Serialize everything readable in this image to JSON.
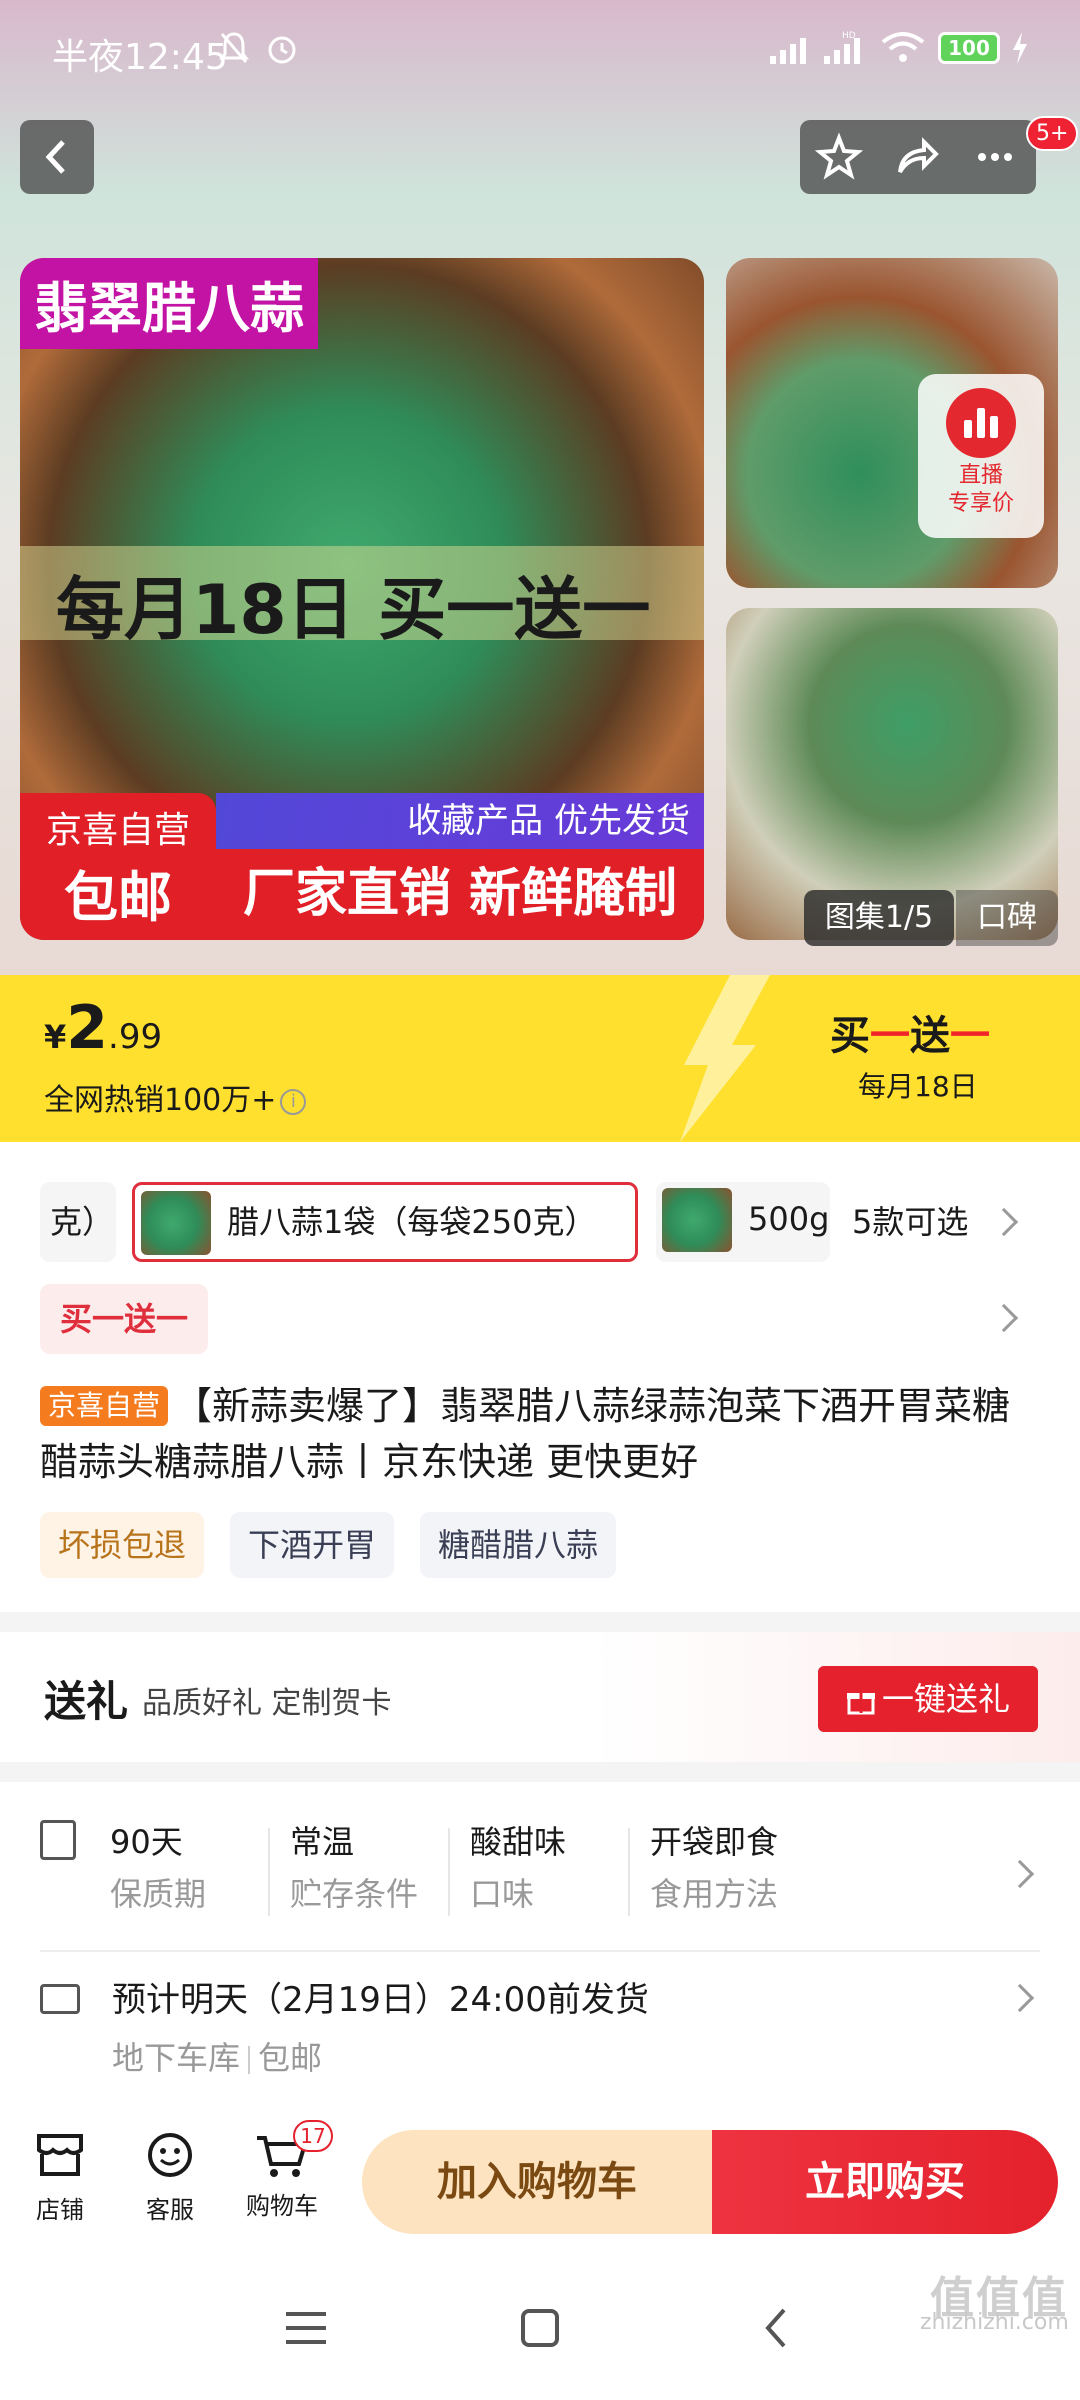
{
  "status_bar": {
    "time": "半夜12:45",
    "battery": "100"
  },
  "header": {
    "cart_badge": "5+"
  },
  "hero": {
    "title": "翡翠腊八蒜",
    "promo": "每月18日 买一送一",
    "self_run_top": "京喜自营",
    "self_run_bottom": "包邮",
    "collect_text": "收藏产品 优先发货",
    "factory_text": "厂家直销 新鲜腌制",
    "live_line1": "直播",
    "live_line2": "专享价",
    "gallery_label": "图集1/5",
    "gallery_extra": "口碑"
  },
  "price_band": {
    "currency": "¥",
    "price_int": "2",
    "price_dec": ".99",
    "sold_text": "全网热销100万+",
    "promo_a": "买",
    "promo_b": "一",
    "promo_c": "送",
    "promo_d": "一",
    "promo_sub": "每月18日"
  },
  "sku": {
    "prev_label": "克）",
    "selected_label": "腊八蒜1袋（每袋250克）",
    "next_label": "500g",
    "count_label": "5款可选"
  },
  "product": {
    "promo_tag": "买一送一",
    "badge": "京喜自营",
    "title": "【新蒜卖爆了】翡翠腊八蒜绿蒜泡菜下酒开胃菜糖醋蒜头糖蒜腊八蒜丨京东快递 更快更好",
    "tags": [
      "坏损包退",
      "下酒开胃",
      "糖醋腊八蒜"
    ]
  },
  "gift": {
    "title": "送礼",
    "subtitle": "品质好礼 定制贺卡",
    "button": "一键送礼"
  },
  "specs": [
    {
      "value": "90天",
      "label": "保质期"
    },
    {
      "value": "常温",
      "label": "贮存条件"
    },
    {
      "value": "酸甜味",
      "label": "口味"
    },
    {
      "value": "开袋即食",
      "label": "食用方法"
    }
  ],
  "shipping": {
    "text": "预计明天（2月19日）24:00前发货",
    "warehouse": "地下车库",
    "free": "包邮"
  },
  "action_bar": {
    "shop": "店铺",
    "service": "客服",
    "cart": "购物车",
    "cart_count": "17",
    "add_to_cart": "加入购物车",
    "buy_now": "立即购买"
  },
  "watermark": {
    "big": "值值值",
    "small": "zhizhizhi.com"
  },
  "colors": {
    "accent_red": "#e4212c",
    "price_yellow": "#ffe02e",
    "self_run_orange": "#f57b1f"
  }
}
